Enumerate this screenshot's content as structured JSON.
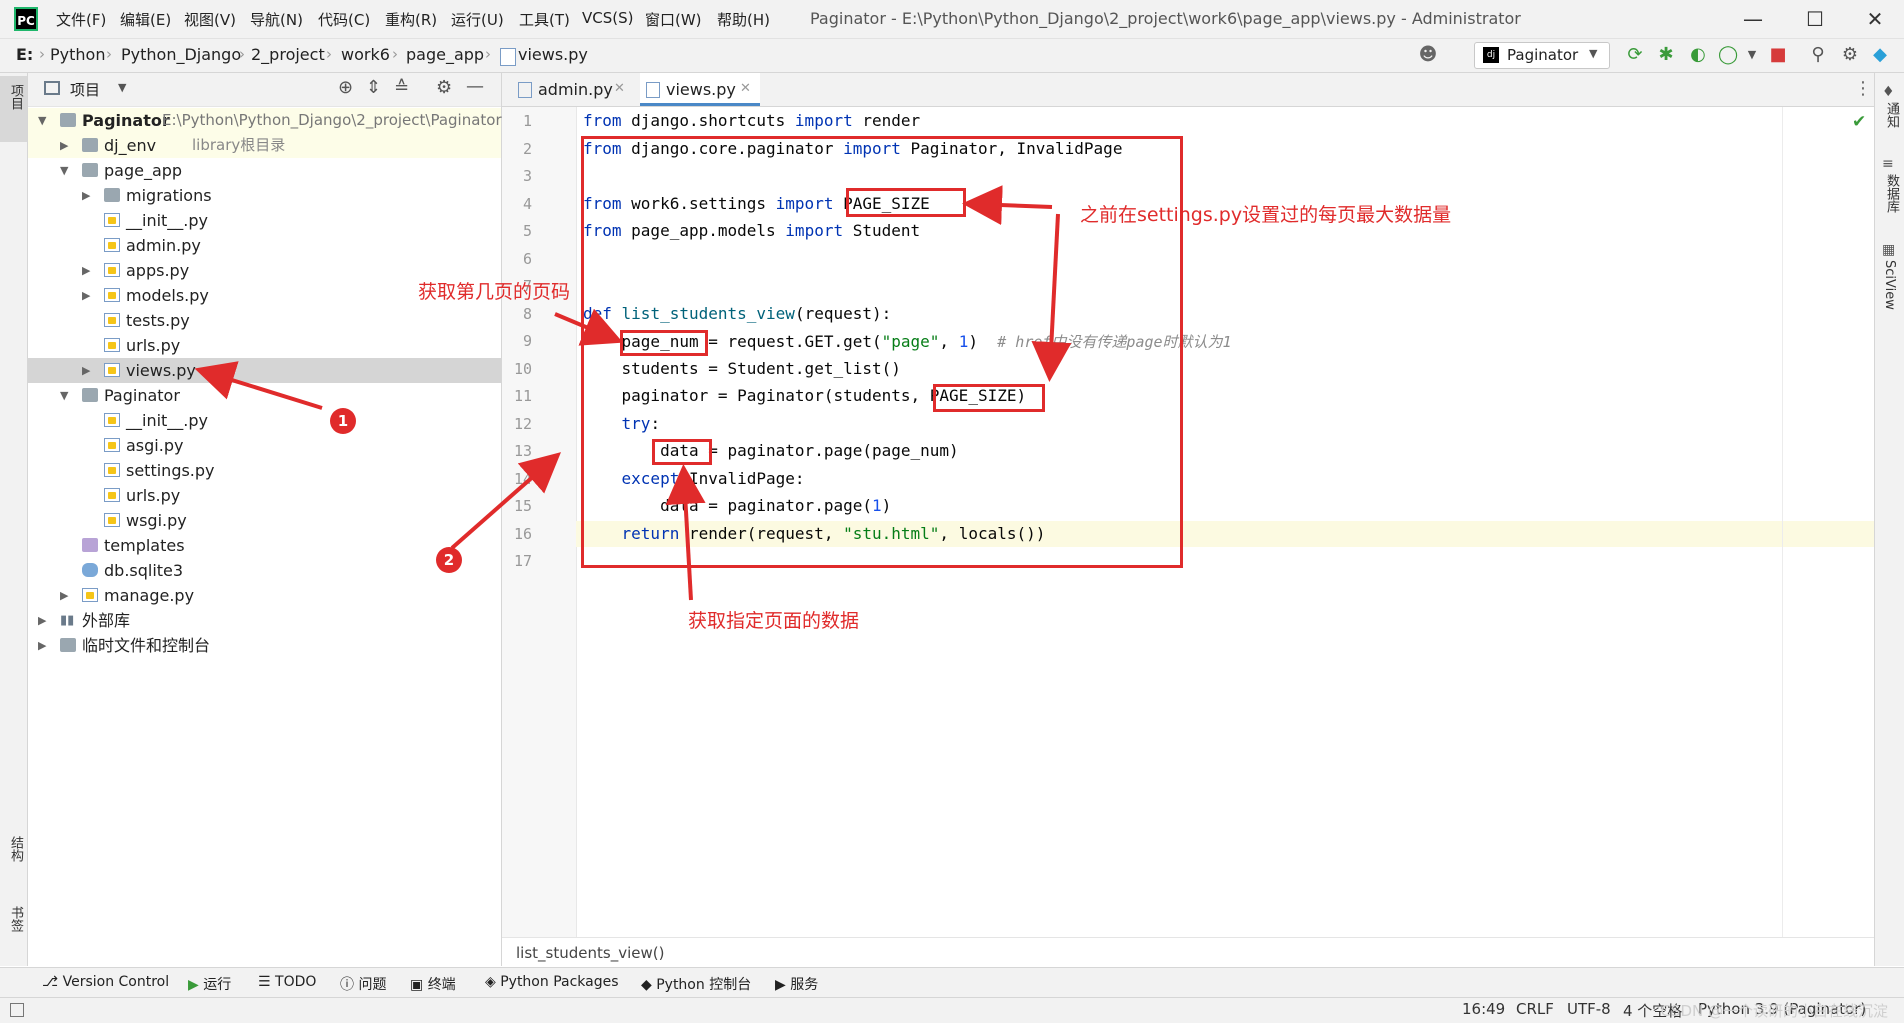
{
  "menu": [
    "文件(F)",
    "编辑(E)",
    "视图(V)",
    "导航(N)",
    "代码(C)",
    "重构(R)",
    "运行(U)",
    "工具(T)",
    "VCS(S)",
    "窗口(W)",
    "帮助(H)"
  ],
  "window_title": "Paginator - E:\\Python\\Python_Django\\2_project\\work6\\page_app\\views.py - Administrator",
  "breadcrumbs": [
    "E:",
    "Python",
    "Python_Django",
    "2_project",
    "work6",
    "page_app",
    "views.py"
  ],
  "run_config": "Paginator",
  "left_strip": {
    "project": "项目",
    "structure": "结构",
    "bookmarks": "书签"
  },
  "right_strip": {
    "notifications": "通知",
    "database": "数据库",
    "sciview": "SciView"
  },
  "project_panel": {
    "title": "项目",
    "tree": [
      {
        "label": "Paginator",
        "path": "E:\\Python\\Python_Django\\2_project\\Paginator",
        "type": "folder",
        "arrow": "v"
      },
      {
        "label": "dj_env",
        "hint": "library根目录",
        "type": "folder",
        "arrow": ">"
      },
      {
        "label": "page_app",
        "type": "folder",
        "arrow": "v"
      },
      {
        "label": "migrations",
        "type": "folder",
        "arrow": ">"
      },
      {
        "label": "__init__.py",
        "type": "py"
      },
      {
        "label": "admin.py",
        "type": "py"
      },
      {
        "label": "apps.py",
        "type": "py",
        "arrow": ">"
      },
      {
        "label": "models.py",
        "type": "py",
        "arrow": ">"
      },
      {
        "label": "tests.py",
        "type": "py"
      },
      {
        "label": "urls.py",
        "type": "py"
      },
      {
        "label": "views.py",
        "type": "py",
        "arrow": ">"
      },
      {
        "label": "Paginator",
        "type": "folder",
        "arrow": "v"
      },
      {
        "label": "__init__.py",
        "type": "py"
      },
      {
        "label": "asgi.py",
        "type": "py"
      },
      {
        "label": "settings.py",
        "type": "py"
      },
      {
        "label": "urls.py",
        "type": "py"
      },
      {
        "label": "wsgi.py",
        "type": "py"
      },
      {
        "label": "templates",
        "type": "folder-purple"
      },
      {
        "label": "db.sqlite3",
        "type": "db"
      },
      {
        "label": "manage.py",
        "type": "py",
        "arrow": ">"
      },
      {
        "label": "外部库",
        "type": "lib",
        "arrow": ">"
      },
      {
        "label": "临时文件和控制台",
        "type": "scratch",
        "arrow": ">"
      }
    ]
  },
  "editor": {
    "tabs": [
      "admin.py",
      "views.py"
    ],
    "active_tab": "views.py",
    "line_numbers": [
      "1",
      "2",
      "3",
      "4",
      "5",
      "6",
      "7",
      "8",
      "9",
      "10",
      "11",
      "12",
      "13",
      "14",
      "15",
      "16",
      "17"
    ],
    "code": {
      "l1": {
        "k1": "from",
        "t1": " django.shortcuts ",
        "k2": "import",
        "t2": " render"
      },
      "l2": {
        "k1": "from",
        "t1": " django.core.paginator ",
        "k2": "import",
        "t2": " Paginator, InvalidPage"
      },
      "l4": {
        "k1": "from",
        "t1": " work6.settings ",
        "k2": "import",
        "t2": " PAGE_SIZE"
      },
      "l5": {
        "k1": "from",
        "t1": " page_app.models ",
        "k2": "import",
        "t2": " Student"
      },
      "l8": {
        "k1": "def",
        "fn": " list_students_view",
        "t1": "(request):"
      },
      "l9": {
        "t1": "    page_num = request.GET.get(",
        "s1": "\"page\"",
        "t2": ", ",
        "n1": "1",
        "t3": ")  ",
        "c1": "# href中没有传递page时默认为1"
      },
      "l10": {
        "t1": "    students = Student.get_list()"
      },
      "l11": {
        "t1": "    paginator = Paginator(students, PAGE_SIZE)"
      },
      "l12": {
        "k1": "    try",
        "t1": ":"
      },
      "l13": {
        "t1": "        data = paginator.page(page_num)"
      },
      "l14": {
        "k1": "    except",
        "t1": " InvalidPage:"
      },
      "l15": {
        "t1": "        data = paginator.page(",
        "n1": "1",
        "t2": ")"
      },
      "l16": {
        "k1": "    return",
        "t1": " render(request, ",
        "s1": "\"stu.html\"",
        "t2": ", locals())"
      }
    },
    "footer_breadcrumb": "list_students_view()"
  },
  "annotations": {
    "page_size_note": "之前在settings.py设置过的每页最大数据量",
    "page_num_note": "获取第几页的页码",
    "data_note": "获取指定页面的数据",
    "badge1": "1",
    "badge2": "2"
  },
  "tool_tabs": [
    "Version Control",
    "运行",
    "TODO",
    "问题",
    "终端",
    "Python Packages",
    "Python 控制台",
    "服务"
  ],
  "status": {
    "position": "16:49",
    "line_sep": "CRLF",
    "encoding": "UTF-8",
    "indent": "4 个空格",
    "interpreter": "Python 3.9 (Paginator)"
  },
  "watermark": "CSDN @一个读研的小白在线沉淀",
  "colors": {
    "annotation": "#e02b2b",
    "keyword": "#0033b3",
    "string": "#067d17",
    "number": "#1750eb",
    "comment": "#8c8c8c",
    "accent": "#4a88c7"
  }
}
